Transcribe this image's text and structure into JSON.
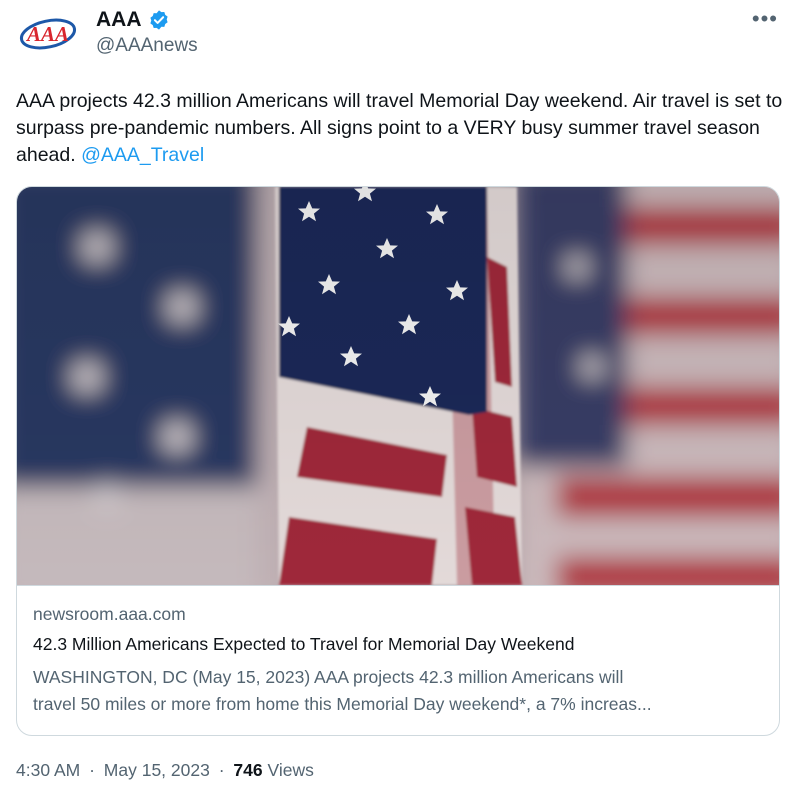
{
  "author": {
    "name": "AAA",
    "handle": "@AAAnews",
    "verified": true,
    "logo_text": "AAA"
  },
  "menu": {
    "more_label": "•••"
  },
  "tweet": {
    "text_lead": "AAA projects 42.3 million Americans will travel Memorial Day weekend. Air travel is set to surpass pre-pandemic numbers. All signs point to a VERY busy summer travel season ahead. ",
    "mention": "@AAA_Travel"
  },
  "card": {
    "domain": "newsroom.aaa.com",
    "title": "42.3 Million Americans Expected to Travel for Memorial Day Weekend",
    "description_line1": "WASHINGTON, DC (May 15, 2023) AAA projects 42.3 million Americans will",
    "description_line2": "travel 50 miles or more from home this Memorial Day weekend*, a 7% increas..."
  },
  "footer": {
    "time": "4:30 AM",
    "separator": "·",
    "date": "May 15, 2023",
    "views_count": "746",
    "views_label": "Views"
  },
  "colors": {
    "link": "#1d9bf0",
    "secondary_text": "#536471",
    "border": "#cfd9de",
    "flag_blue": "#1f2c5c",
    "flag_red": "#a8263a"
  }
}
